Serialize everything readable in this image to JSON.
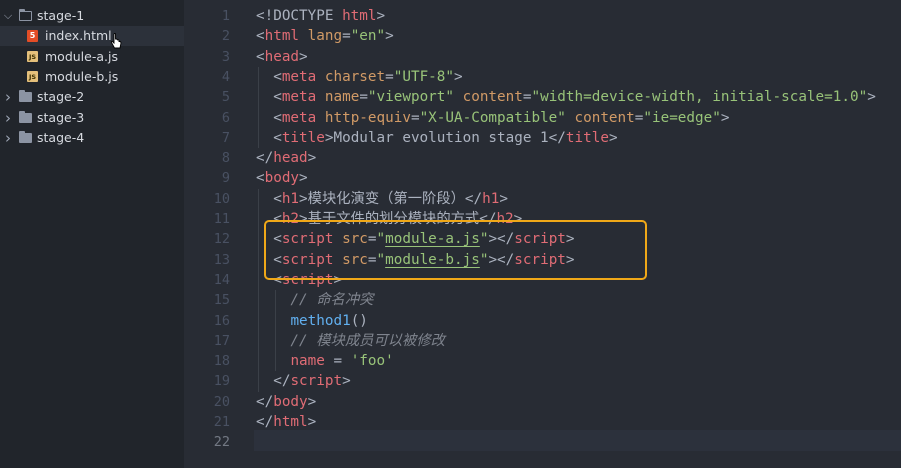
{
  "explorer": {
    "items": [
      {
        "name": "stage-1",
        "type": "folder",
        "expanded": true,
        "depth": 0
      },
      {
        "name": "index.html",
        "type": "html",
        "depth": 1,
        "selected": true
      },
      {
        "name": "module-a.js",
        "type": "js",
        "depth": 1
      },
      {
        "name": "module-b.js",
        "type": "js",
        "depth": 1
      },
      {
        "name": "stage-2",
        "type": "folder",
        "expanded": false,
        "depth": 0
      },
      {
        "name": "stage-3",
        "type": "folder",
        "expanded": false,
        "depth": 0
      },
      {
        "name": "stage-4",
        "type": "folder",
        "expanded": false,
        "depth": 0
      }
    ]
  },
  "editor": {
    "current_line": 22,
    "lines": [
      [
        [
          "pun",
          "<!DOCTYPE "
        ],
        [
          "tag",
          "html"
        ],
        [
          "pun",
          ">"
        ]
      ],
      [
        [
          "pun",
          "<"
        ],
        [
          "tag",
          "html"
        ],
        [
          "pun",
          " "
        ],
        [
          "attr",
          "lang"
        ],
        [
          "pun",
          "="
        ],
        [
          "str",
          "\"en\""
        ],
        [
          "pun",
          ">"
        ]
      ],
      [
        [
          "pun",
          "<"
        ],
        [
          "tag",
          "head"
        ],
        [
          "pun",
          ">"
        ]
      ],
      [
        [
          "pun",
          "  <"
        ],
        [
          "tag",
          "meta"
        ],
        [
          "pun",
          " "
        ],
        [
          "attr",
          "charset"
        ],
        [
          "pun",
          "="
        ],
        [
          "str",
          "\"UTF-8\""
        ],
        [
          "pun",
          ">"
        ]
      ],
      [
        [
          "pun",
          "  <"
        ],
        [
          "tag",
          "meta"
        ],
        [
          "pun",
          " "
        ],
        [
          "attr",
          "name"
        ],
        [
          "pun",
          "="
        ],
        [
          "str",
          "\"viewport\""
        ],
        [
          "pun",
          " "
        ],
        [
          "attr",
          "content"
        ],
        [
          "pun",
          "="
        ],
        [
          "str",
          "\"width=device-width, initial-scale=1.0\""
        ],
        [
          "pun",
          ">"
        ]
      ],
      [
        [
          "pun",
          "  <"
        ],
        [
          "tag",
          "meta"
        ],
        [
          "pun",
          " "
        ],
        [
          "attr",
          "http-equiv"
        ],
        [
          "pun",
          "="
        ],
        [
          "str",
          "\"X-UA-Compatible\""
        ],
        [
          "pun",
          " "
        ],
        [
          "attr",
          "content"
        ],
        [
          "pun",
          "="
        ],
        [
          "str",
          "\"ie=edge\""
        ],
        [
          "pun",
          ">"
        ]
      ],
      [
        [
          "pun",
          "  <"
        ],
        [
          "tag",
          "title"
        ],
        [
          "pun",
          ">Modular evolution stage 1</"
        ],
        [
          "tag",
          "title"
        ],
        [
          "pun",
          ">"
        ]
      ],
      [
        [
          "pun",
          "</"
        ],
        [
          "tag",
          "head"
        ],
        [
          "pun",
          ">"
        ]
      ],
      [
        [
          "pun",
          "<"
        ],
        [
          "tag",
          "body"
        ],
        [
          "pun",
          ">"
        ]
      ],
      [
        [
          "pun",
          "  <"
        ],
        [
          "tag",
          "h1"
        ],
        [
          "pun",
          ">模块化演变（第一阶段）</"
        ],
        [
          "tag",
          "h1"
        ],
        [
          "pun",
          ">"
        ]
      ],
      [
        [
          "pun",
          "  <"
        ],
        [
          "tag",
          "h2"
        ],
        [
          "pun",
          ">基于文件的划分模块的方式</"
        ],
        [
          "tag",
          "h2"
        ],
        [
          "pun",
          ">"
        ]
      ],
      [
        [
          "pun",
          "  <"
        ],
        [
          "tag",
          "script"
        ],
        [
          "pun",
          " "
        ],
        [
          "attr",
          "src"
        ],
        [
          "pun",
          "="
        ],
        [
          "str",
          "\""
        ],
        [
          "str under",
          "module-a.js"
        ],
        [
          "str",
          "\""
        ],
        [
          "pun",
          "></"
        ],
        [
          "tag",
          "script"
        ],
        [
          "pun",
          ">"
        ]
      ],
      [
        [
          "pun",
          "  <"
        ],
        [
          "tag",
          "script"
        ],
        [
          "pun",
          " "
        ],
        [
          "attr",
          "src"
        ],
        [
          "pun",
          "="
        ],
        [
          "str",
          "\""
        ],
        [
          "str under",
          "module-b.js"
        ],
        [
          "str",
          "\""
        ],
        [
          "pun",
          "></"
        ],
        [
          "tag",
          "script"
        ],
        [
          "pun",
          ">"
        ]
      ],
      [
        [
          "pun",
          "  <"
        ],
        [
          "tag",
          "script"
        ],
        [
          "pun",
          ">"
        ]
      ],
      [
        [
          "cmt",
          "    // 命名冲突"
        ]
      ],
      [
        [
          "pun",
          "    "
        ],
        [
          "fn",
          "method1"
        ],
        [
          "pun",
          "()"
        ]
      ],
      [
        [
          "cmt",
          "    // 模块成员可以被修改"
        ]
      ],
      [
        [
          "pun",
          "    "
        ],
        [
          "tag",
          "name"
        ],
        [
          "pun",
          " = "
        ],
        [
          "str",
          "'foo'"
        ]
      ],
      [
        [
          "pun",
          "  </"
        ],
        [
          "tag",
          "script"
        ],
        [
          "pun",
          ">"
        ]
      ],
      [
        [
          "pun",
          "</"
        ],
        [
          "tag",
          "body"
        ],
        [
          "pun",
          ">"
        ]
      ],
      [
        [
          "pun",
          "</"
        ],
        [
          "tag",
          "html"
        ],
        [
          "pun",
          ">"
        ]
      ],
      [
        [
          "pun",
          ""
        ]
      ]
    ]
  }
}
